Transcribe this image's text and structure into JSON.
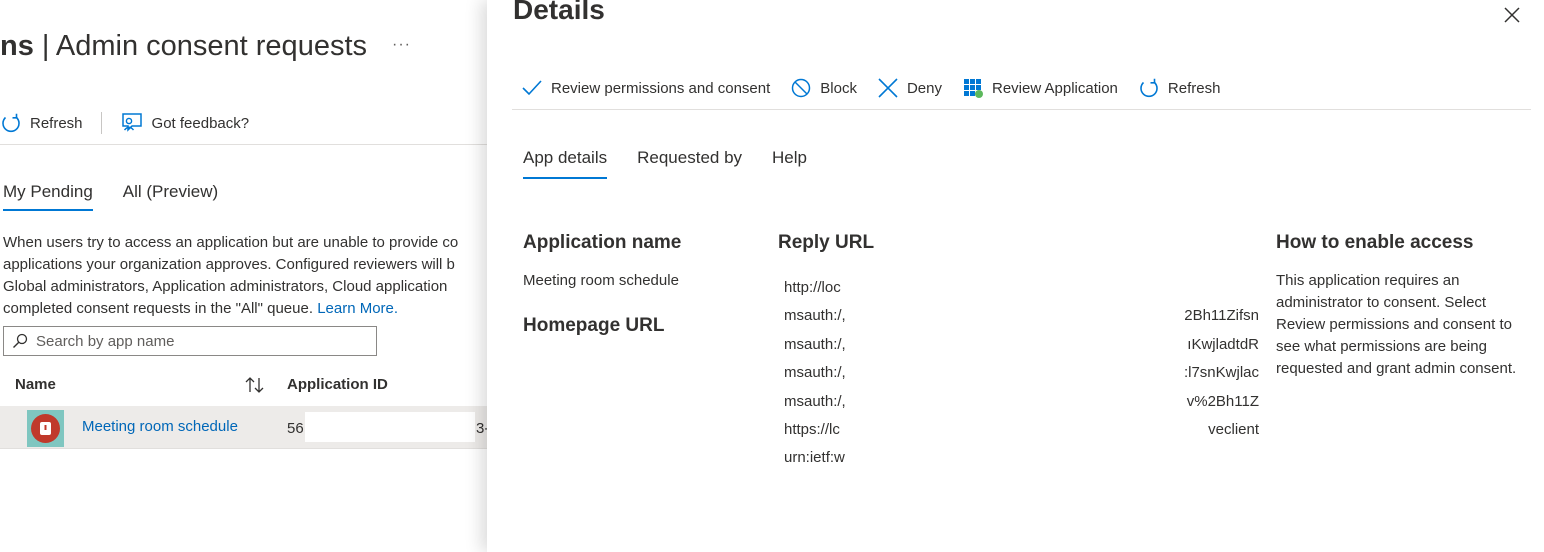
{
  "background": {
    "title_prefix": "ns",
    "title_rest": " | Admin consent requests",
    "more_label": "···",
    "toolbar": {
      "refresh_label": "Refresh",
      "feedback_label": "Got feedback?"
    },
    "tabs": [
      {
        "label": "My Pending",
        "active": true
      },
      {
        "label": "All (Preview)",
        "active": false
      }
    ],
    "description_lines": [
      "When users try to access an application but are unable to provide co",
      "applications your organization approves. Configured reviewers will b",
      "Global administrators, Application administrators, Cloud application",
      "completed consent requests in the \"All\" queue."
    ],
    "learn_more": "Learn More.",
    "search_placeholder": "Search by app name",
    "table": {
      "col_name": "Name",
      "col_app_id": "Application ID",
      "row": {
        "name": "Meeting room schedule",
        "app_id_start": "56",
        "app_id_end": "3-"
      }
    }
  },
  "panel": {
    "title": "Details",
    "toolbar": {
      "review_permissions": "Review permissions and consent",
      "block": "Block",
      "deny": "Deny",
      "review_application": "Review Application",
      "refresh": "Refresh"
    },
    "tabs": [
      {
        "label": "App details",
        "active": true
      },
      {
        "label": "Requested by",
        "active": false
      },
      {
        "label": "Help",
        "active": false
      }
    ],
    "app_name_heading": "Application name",
    "app_name_value": "Meeting room schedule",
    "homepage_heading": "Homepage URL",
    "reply_url_heading": "Reply URL",
    "reply_urls": [
      {
        "start": "http://loc",
        "end": ""
      },
      {
        "start": "msauth:/,",
        "end": "2Bh11Zifsn"
      },
      {
        "start": "msauth:/,",
        "end": "ıKwjladtdR"
      },
      {
        "start": "msauth:/,",
        "end": ":l7snKwjlac"
      },
      {
        "start": "msauth:/,",
        "end": "v%2Bh11Z"
      },
      {
        "start": "https://lc",
        "end": "veclient"
      },
      {
        "start": "urn:ietf:w",
        "end": ""
      }
    ],
    "enable_heading": "How to enable access",
    "enable_text": "This application requires an administrator to consent. Select Review permissions and consent to see what permissions are being requested and grant admin consent."
  },
  "colors": {
    "accent": "#0078d4",
    "link": "#0067b8",
    "text": "#323130"
  }
}
